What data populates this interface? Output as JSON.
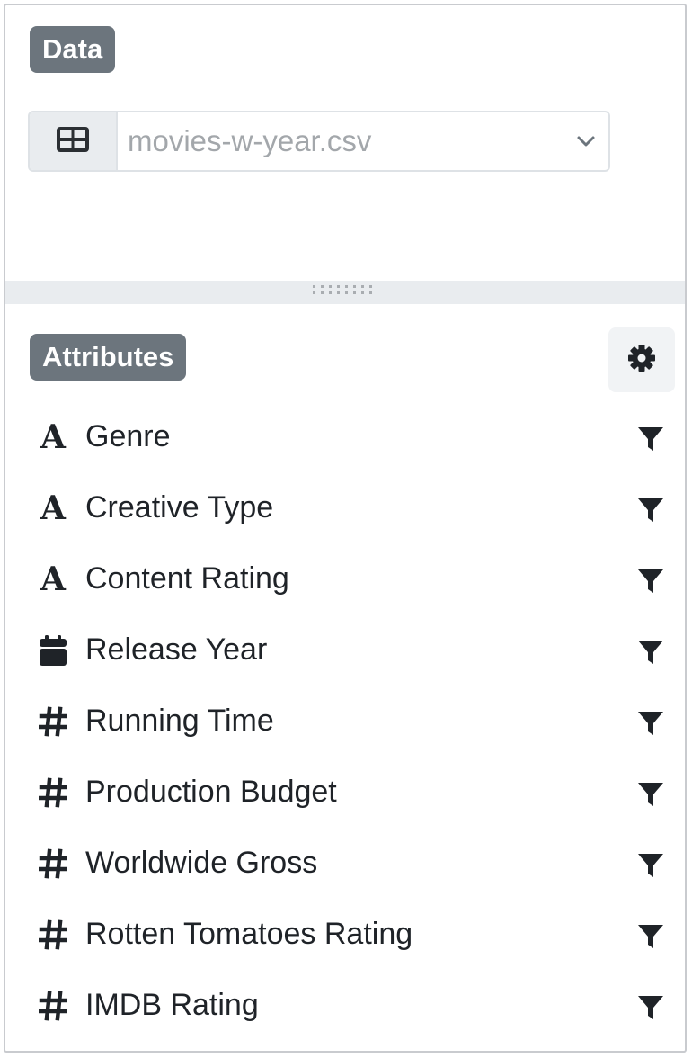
{
  "data_section": {
    "badge": "Data",
    "dataset_icon": "table-icon",
    "dataset_value": "movies-w-year.csv",
    "caret_icon": "chevron-down-icon"
  },
  "attributes_section": {
    "badge": "Attributes",
    "settings_icon": "gear-icon",
    "items": [
      {
        "label": "Genre",
        "type_icon": "text-type-icon",
        "filter_icon": "filter-icon"
      },
      {
        "label": "Creative Type",
        "type_icon": "text-type-icon",
        "filter_icon": "filter-icon"
      },
      {
        "label": "Content Rating",
        "type_icon": "text-type-icon",
        "filter_icon": "filter-icon"
      },
      {
        "label": "Release Year",
        "type_icon": "calendar-icon",
        "filter_icon": "filter-icon"
      },
      {
        "label": "Running Time",
        "type_icon": "hash-icon",
        "filter_icon": "filter-icon"
      },
      {
        "label": "Production Budget",
        "type_icon": "hash-icon",
        "filter_icon": "filter-icon"
      },
      {
        "label": "Worldwide Gross",
        "type_icon": "hash-icon",
        "filter_icon": "filter-icon"
      },
      {
        "label": "Rotten Tomatoes Rating",
        "type_icon": "hash-icon",
        "filter_icon": "filter-icon"
      },
      {
        "label": "IMDB Rating",
        "type_icon": "hash-icon",
        "filter_icon": "filter-icon"
      }
    ]
  },
  "colors": {
    "badge_bg": "#6c757d",
    "splitter_bg": "#e9ecef",
    "text": "#1f2328",
    "placeholder_text": "#a3a7ab"
  }
}
